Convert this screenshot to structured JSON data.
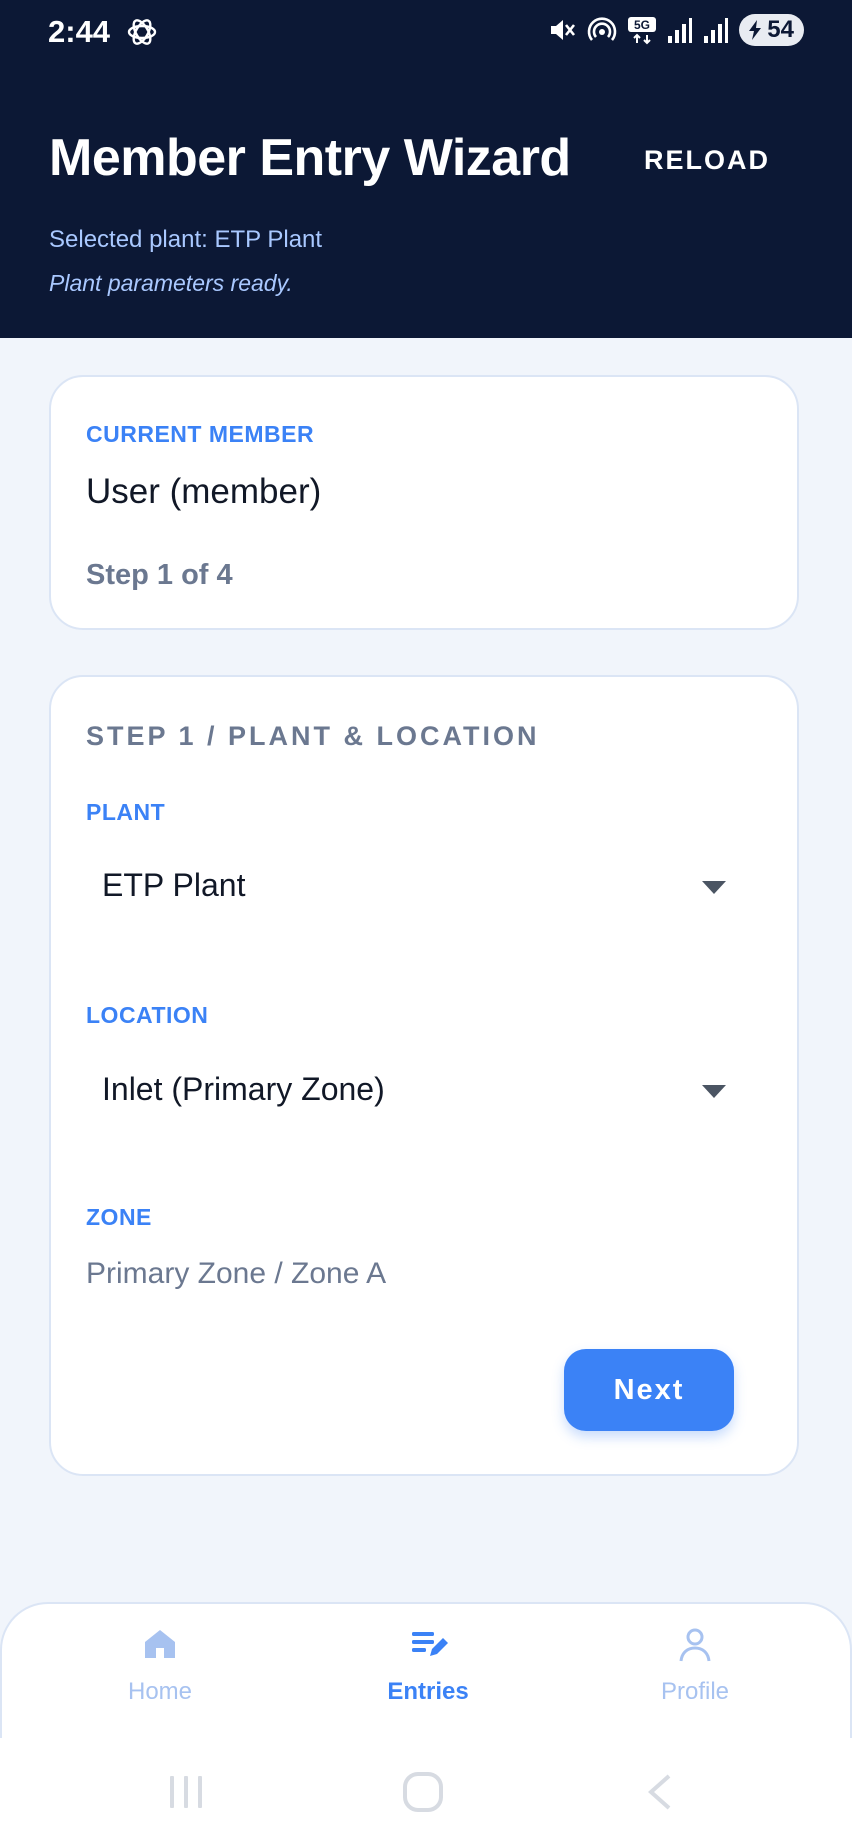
{
  "status_bar": {
    "time": "2:44",
    "battery": "54",
    "icons": [
      "chatgpt-icon",
      "mute-icon",
      "hotspot-icon",
      "5g-icon",
      "signal-icon",
      "signal-icon",
      "battery-icon"
    ]
  },
  "header": {
    "title": "Member Entry Wizard",
    "reload_label": "RELOAD",
    "selected_plant": "Selected plant: ETP Plant",
    "status_message": "Plant parameters ready."
  },
  "member_card": {
    "label": "CURRENT MEMBER",
    "name": "User (member)",
    "step_text": "Step 1 of 4"
  },
  "step_card": {
    "section_title": "STEP 1 / PLANT & LOCATION",
    "plant_label": "PLANT",
    "plant_value": "ETP Plant",
    "location_label": "LOCATION",
    "location_value": "Inlet (Primary Zone)",
    "zone_label": "ZONE",
    "zone_value": "Primary Zone / Zone A",
    "next_label": "Next"
  },
  "bottom_nav": {
    "items": [
      {
        "label": "Home",
        "icon": "home-icon",
        "active": false
      },
      {
        "label": "Entries",
        "icon": "entries-icon",
        "active": true
      },
      {
        "label": "Profile",
        "icon": "profile-icon",
        "active": false
      }
    ]
  },
  "colors": {
    "header_bg": "#0c1835",
    "accent": "#3b82f6",
    "page_bg": "#f1f5fb",
    "muted_text": "#6b7890"
  }
}
